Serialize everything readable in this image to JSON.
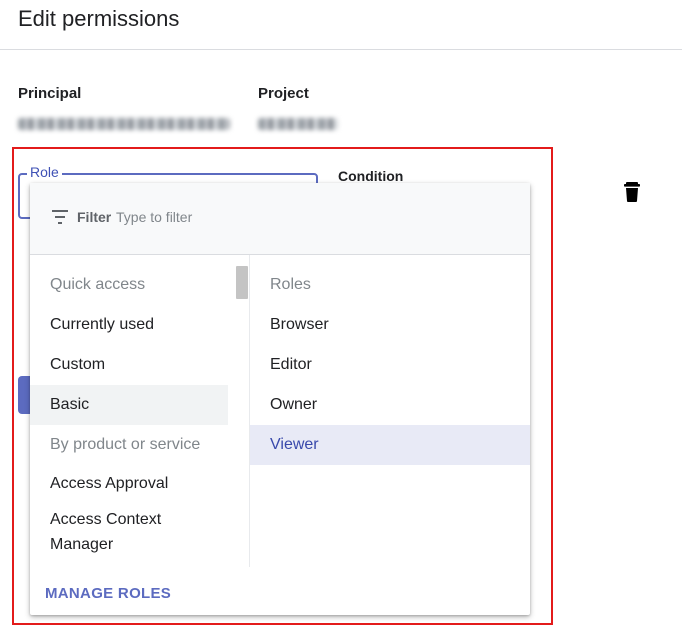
{
  "dialog": {
    "title": "Edit permissions"
  },
  "principal": {
    "label": "Principal"
  },
  "project": {
    "label": "Project"
  },
  "role": {
    "label": "Role"
  },
  "condition": {
    "label": "Condition"
  },
  "filter": {
    "label": "Filter",
    "placeholder": "Type to filter"
  },
  "left_list": {
    "items": [
      {
        "label": "Quick access",
        "kind": "header"
      },
      {
        "label": "Currently used",
        "kind": "option"
      },
      {
        "label": "Custom",
        "kind": "option"
      },
      {
        "label": "Basic",
        "kind": "option",
        "selected": true
      },
      {
        "label": "By product or service",
        "kind": "header"
      },
      {
        "label": "Access Approval",
        "kind": "option"
      },
      {
        "label": "Access Context Manager",
        "kind": "option"
      }
    ]
  },
  "right_list": {
    "items": [
      {
        "label": "Roles",
        "kind": "header"
      },
      {
        "label": "Browser",
        "kind": "option"
      },
      {
        "label": "Editor",
        "kind": "option"
      },
      {
        "label": "Owner",
        "kind": "option"
      },
      {
        "label": "Viewer",
        "kind": "option",
        "active": true
      }
    ]
  },
  "footer": {
    "manage_roles": "MANAGE ROLES"
  },
  "icons": {
    "delete": "trash-icon",
    "filter": "filter-icon"
  },
  "colors": {
    "accent": "#5c6bc0",
    "highlight_border": "#e31b1b",
    "active_row": "#e8eaf6"
  }
}
